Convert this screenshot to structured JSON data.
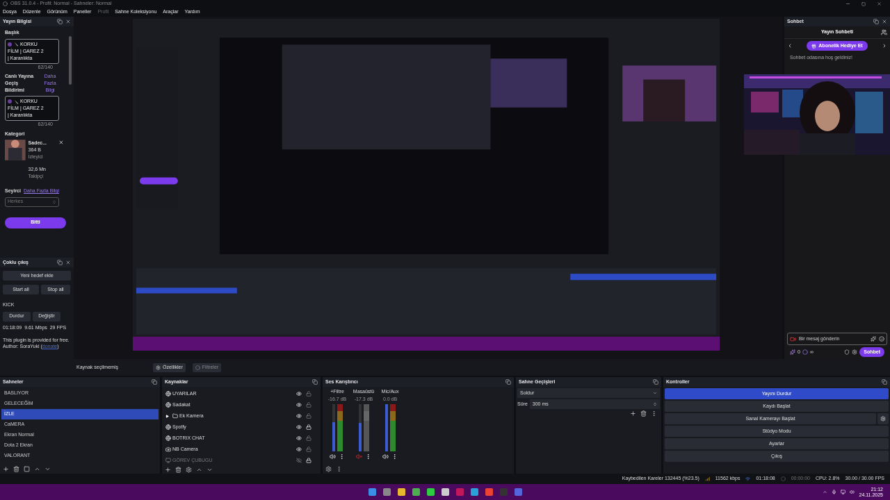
{
  "window": {
    "title": "OBS 31.0.4 - Profil: Normal - Sahneler: Normal"
  },
  "menu": [
    {
      "label": "Dosya",
      "disabled": false
    },
    {
      "label": "Düzenle",
      "disabled": false
    },
    {
      "label": "Görünüm",
      "disabled": false
    },
    {
      "label": "Paneller",
      "disabled": false
    },
    {
      "label": "Profil",
      "disabled": true
    },
    {
      "label": "Sahne Koleksiyonu",
      "disabled": false
    },
    {
      "label": "Araçlar",
      "disabled": false
    },
    {
      "label": "Yardım",
      "disabled": false
    }
  ],
  "stream_info": {
    "title": "Yayın Bilgisi",
    "title_label": "Başlık",
    "title_lines": [
      "KORKU",
      "FİLM | GAREZ 2",
      "| Karanlıkta"
    ],
    "title_count": "62/140",
    "notif_label": "Canlı Yayına Geçiş Bildirimi",
    "notif_link": "Daha Fazla Bilgi",
    "notif_lines": [
      "KORKU",
      "FİLM | GAREZ 2",
      "| Karanlıkta"
    ],
    "notif_count": "62/140",
    "category_label": "Kategori",
    "category_name": "Sadec...",
    "viewers": "364 B",
    "viewers_label": "İzleyici",
    "followers": "32,6 Mn",
    "followers_label": "Takipçi",
    "audience_label": "Seyirci",
    "audience_link": "Daha Fazla Bilgi",
    "audience_placeholder": "Herkes",
    "done_button": "Bitti"
  },
  "multi_output": {
    "title": "Çoklu çıkış",
    "add_target": "Yeni hedef ekle",
    "start_all": "Start all",
    "stop_all": "Stop all",
    "targets": [
      {
        "name": "KICK",
        "stop": "Durdur",
        "edit": "Değiştir",
        "stats": "01:18:09  9.61 Mbps  29 FPS"
      }
    ],
    "footer_before": "This plugin is provided for free. Author: SoraYuki (",
    "footer_link": "donate",
    "footer_after": ")"
  },
  "chat": {
    "title": "Sohbet",
    "header": "Yayın Sohbeti",
    "gift_button": "Abonelik Hediye Et",
    "welcome": "Sohbet odasına hoş geldiniz!",
    "input_placeholder": "Bir mesaj gönderin",
    "points": "0",
    "infinity": "∞",
    "send_button": "Sohbet"
  },
  "source_bar": {
    "status": "Kaynak seçilmemiş",
    "properties": "Özellikler",
    "filters": "Filtreler"
  },
  "scenes": {
    "title": "Sahneler",
    "items": [
      {
        "label": "BASLIYOR",
        "selected": false
      },
      {
        "label": "GELECEĞİM",
        "selected": false
      },
      {
        "label": "İZLE",
        "selected": true
      },
      {
        "label": "CaMERA",
        "selected": false
      },
      {
        "label": "Ekran Normal",
        "selected": false
      },
      {
        "label": "Dota 2 Ekran",
        "selected": false
      },
      {
        "label": "VALORANT",
        "selected": false
      }
    ]
  },
  "sources": {
    "title": "Kaynaklar",
    "items": [
      {
        "label": "UYARILAR",
        "kind": "browser",
        "visible": true,
        "locked": false
      },
      {
        "label": "Sadakat",
        "kind": "browser",
        "visible": true,
        "locked": false
      },
      {
        "label": "Ek Kamera",
        "kind": "group",
        "visible": true,
        "locked": false
      },
      {
        "label": "Spotfy",
        "kind": "browser",
        "visible": true,
        "locked": true
      },
      {
        "label": "BOTRIX CHAT",
        "kind": "browser",
        "visible": true,
        "locked": false
      },
      {
        "label": "NB Camera",
        "kind": "camera",
        "visible": true,
        "locked": false
      },
      {
        "label": "GÖREV ÇUBUGU",
        "kind": "display",
        "visible": false,
        "locked": true
      }
    ]
  },
  "mixer": {
    "title": "Ses Karıştırıcı",
    "channels": [
      {
        "name": "+Filtre",
        "reading": "-16.7 dB",
        "level": 0.62,
        "muted": false
      },
      {
        "name": "Masaüstü",
        "reading": "-17.3 dB",
        "level": 0.6,
        "muted": true
      },
      {
        "name": "Mic/Aux",
        "reading": "0.0 dB",
        "level": 1,
        "muted": false
      }
    ]
  },
  "transitions": {
    "title": "Sahne Geçişleri",
    "selected": "Soldur",
    "duration_label": "Süre",
    "duration": "300 ms"
  },
  "controls": {
    "title": "Kontroller",
    "buttons": [
      {
        "label": "Yayını Durdur",
        "active": true,
        "settings": false
      },
      {
        "label": "Kaydı Başlat",
        "active": false,
        "settings": false
      },
      {
        "label": "Sanal Kamerayı Başlat",
        "active": false,
        "settings": true
      },
      {
        "label": "Stüdyo Modu",
        "active": false,
        "settings": false
      },
      {
        "label": "Ayarlar",
        "active": false,
        "settings": false
      },
      {
        "label": "Çıkış",
        "active": false,
        "settings": false
      }
    ]
  },
  "status_bar": {
    "dropped": "Kaybedilen Kareler 132445 (%23.5)",
    "bitrate": "11562 kbps",
    "stream_time": "01:18:08",
    "record_time": "00:00:00",
    "cpu": "CPU: 2.8%",
    "fps": "30.00 / 30.00 FPS"
  },
  "taskbar": {
    "time": "21:12",
    "date": "24.11.2025"
  }
}
